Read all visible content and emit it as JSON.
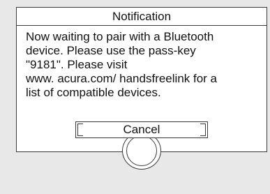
{
  "dialog": {
    "title": "Notification",
    "message_lines": [
      "Now waiting to pair with a Bluetooth",
      "device. Please use the pass-key",
      "\"9181\". Please visit",
      "www. acura.com/ handsfreelink for a",
      "list of compatible devices."
    ],
    "cancel_label": "Cancel"
  }
}
